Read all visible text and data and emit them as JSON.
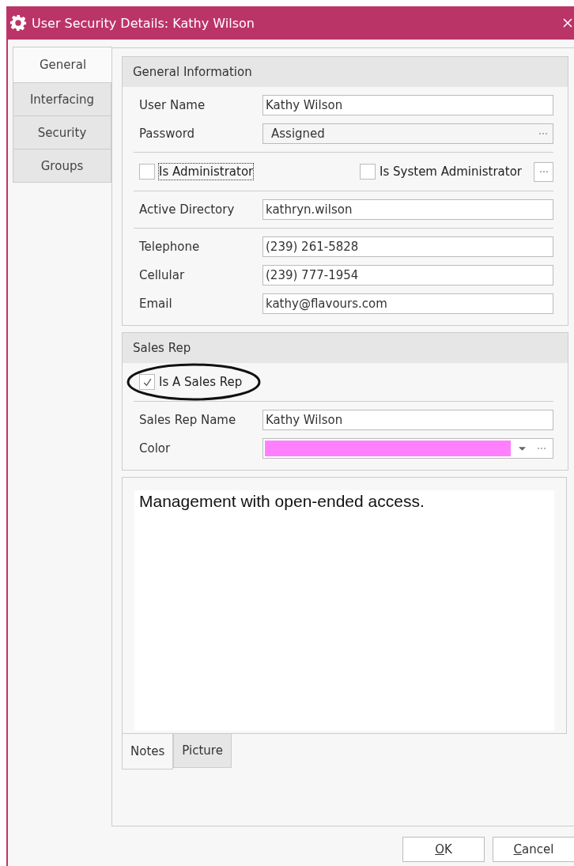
{
  "window": {
    "title": "User Security Details:  Kathy Wilson"
  },
  "side_tabs": [
    {
      "label": "General",
      "selected": true
    },
    {
      "label": "Interfacing",
      "selected": false
    },
    {
      "label": "Security",
      "selected": false
    },
    {
      "label": "Groups",
      "selected": false
    }
  ],
  "general_information": {
    "title": "General Information",
    "sections": [
      [
        {
          "kind": "text",
          "label": "User Name",
          "value": "Kathy Wilson"
        },
        {
          "kind": "ellipsis",
          "label": "Password",
          "value": "Assigned"
        }
      ],
      [
        {
          "kind": "checkboxes",
          "items": [
            {
              "label": "Is Administrator",
              "checked": false,
              "focused": true
            },
            {
              "label": "Is System Administrator",
              "checked": false,
              "focused": false
            }
          ]
        }
      ],
      [
        {
          "kind": "text",
          "label": "Active Directory",
          "value": "kathryn.wilson"
        }
      ],
      [
        {
          "kind": "text",
          "label": "Telephone",
          "value": "(239) 261-5828"
        },
        {
          "kind": "text",
          "label": "Cellular",
          "value": "(239) 777-1954"
        },
        {
          "kind": "text",
          "label": "Email",
          "value": "kathy@flavours.com"
        }
      ]
    ]
  },
  "sales_rep": {
    "title": "Sales Rep",
    "sections": [
      [
        {
          "kind": "checkboxes",
          "highlighted": true,
          "items": [
            {
              "label": "Is A Sales Rep",
              "checked": true,
              "focused": false
            }
          ]
        }
      ],
      [
        {
          "kind": "text",
          "label": "Sales Rep Name",
          "value": "Kathy Wilson"
        },
        {
          "kind": "color",
          "label": "Color",
          "color": "#ff80ff"
        }
      ]
    ]
  },
  "notes": {
    "text": "Management with open-ended access.",
    "tabs": [
      {
        "label": "Notes",
        "selected": true
      },
      {
        "label": "Picture",
        "selected": false
      }
    ]
  },
  "buttons": [
    {
      "label": "OK"
    },
    {
      "label": "Cancel"
    }
  ]
}
